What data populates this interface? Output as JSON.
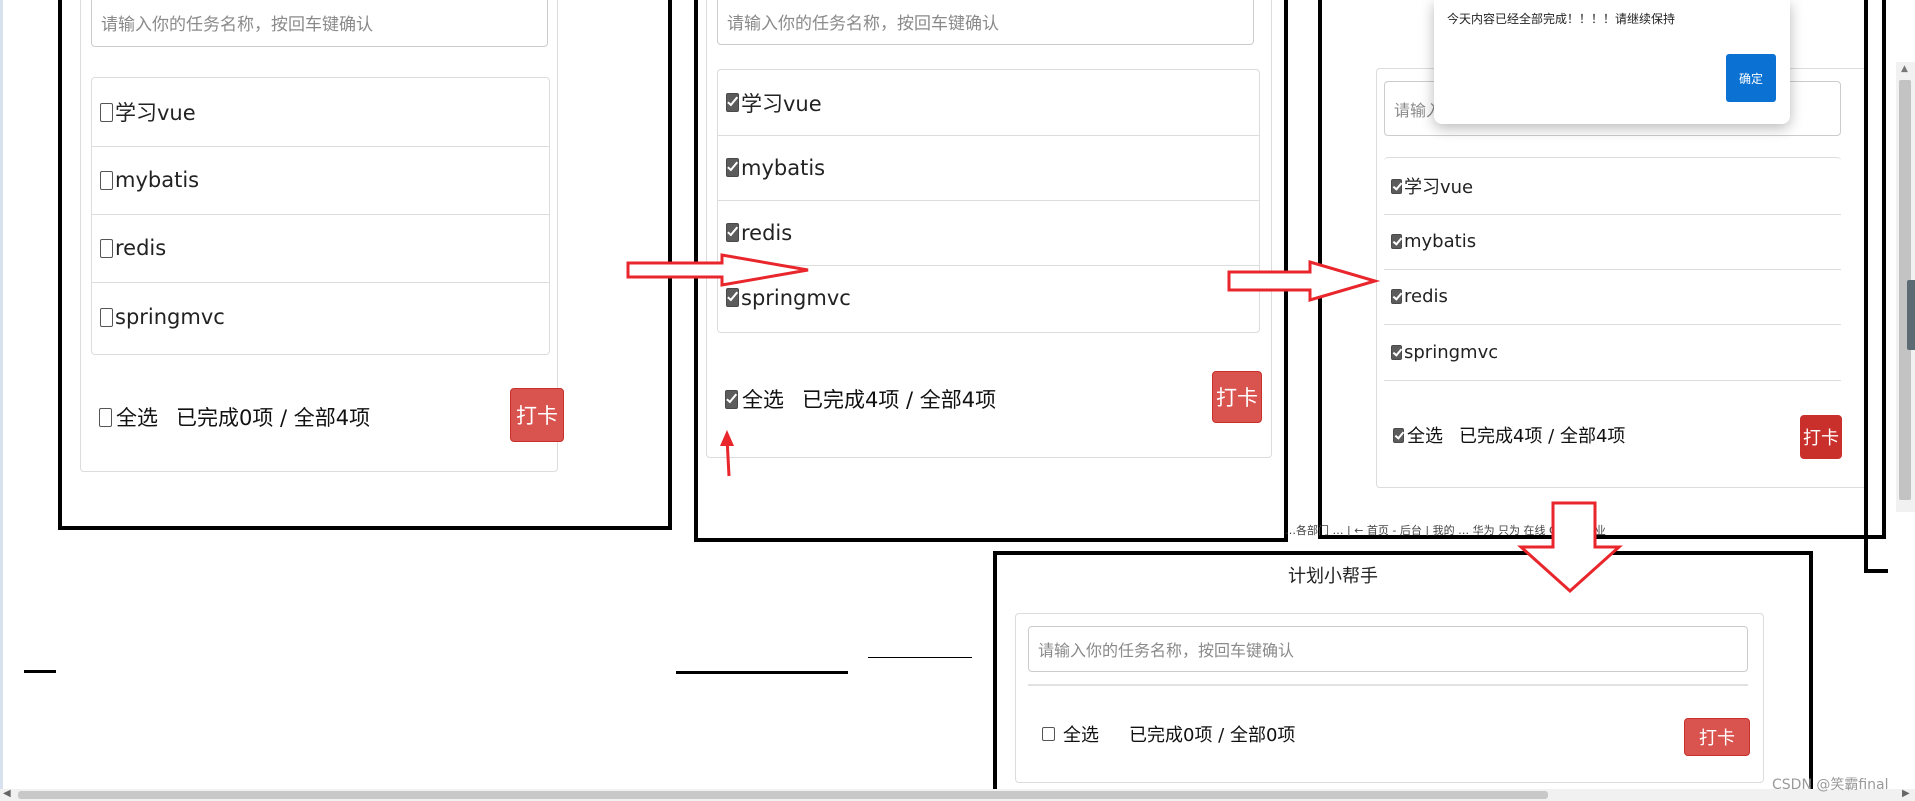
{
  "placeholder": "请输入你的任务名称，按回车键确认",
  "tasks": [
    "学习vue",
    "mybatis",
    "redis",
    "springmvc"
  ],
  "select_all_label": "全选",
  "checkin_button": "打卡",
  "panel1": {
    "summary": "已完成0项 / 全部4项"
  },
  "panel2": {
    "summary": "已完成4项 / 全部4项"
  },
  "panel3": {
    "input_partial": "请输入你",
    "summary": "已完成4项 / 全部4项",
    "dialog": {
      "message": "今天内容已经全部完成！！！！请继续保持",
      "confirm": "确定"
    },
    "bookmarks": "…各部门 … | ← 首页 - 后台 | 我的 …   华为 只为 在线  CSDN  专业"
  },
  "panel4": {
    "title": "计划小帮手",
    "summary": "已完成0项 / 全部0项"
  },
  "watermark": "CSDN @笑霸final",
  "colors": {
    "danger": "#d9534f",
    "dialog_button": "#0b72d3",
    "annotation_arrow": "#e8262b"
  }
}
